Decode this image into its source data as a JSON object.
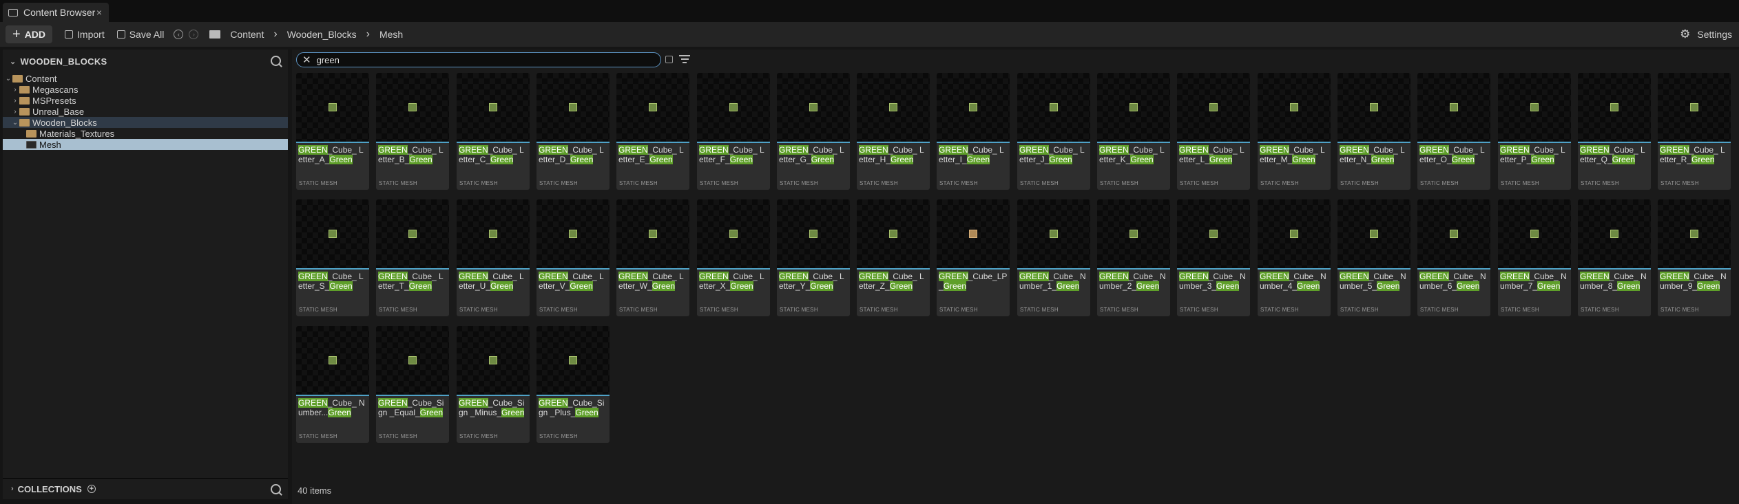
{
  "tab": {
    "title": "Content Browser",
    "close": "×"
  },
  "toolbar": {
    "add_label": "ADD",
    "import_label": "Import",
    "save_all_label": "Save All",
    "breadcrumbs": [
      "Content",
      "Wooden_Blocks",
      "Mesh"
    ],
    "settings_label": "Settings"
  },
  "sources": {
    "title": "WOODEN_BLOCKS",
    "tree": [
      {
        "label": "Content",
        "depth": 0,
        "expanded": true
      },
      {
        "label": "Megascans",
        "depth": 1,
        "expanded": false
      },
      {
        "label": "MSPresets",
        "depth": 1,
        "expanded": false
      },
      {
        "label": "Unreal_Base",
        "depth": 1,
        "expanded": false
      },
      {
        "label": "Wooden_Blocks",
        "depth": 1,
        "expanded": true
      },
      {
        "label": "Materials_Textures",
        "depth": 2,
        "expanded": false
      },
      {
        "label": "Mesh",
        "depth": 2,
        "selected": true
      }
    ]
  },
  "collections": {
    "title": "COLLECTIONS"
  },
  "search": {
    "value": "green"
  },
  "assets": [
    {
      "prefix": "GREEN",
      "middle": "_Cube_ Letter_A_",
      "suffix": "Green",
      "type": "STATIC MESH"
    },
    {
      "prefix": "GREEN",
      "middle": "_Cube_ Letter_B_",
      "suffix": "Green",
      "type": "STATIC MESH"
    },
    {
      "prefix": "GREEN",
      "middle": "_Cube_ Letter_C_",
      "suffix": "Green",
      "type": "STATIC MESH"
    },
    {
      "prefix": "GREEN",
      "middle": "_Cube_ Letter_D_",
      "suffix": "Green",
      "type": "STATIC MESH"
    },
    {
      "prefix": "GREEN",
      "middle": "_Cube_ Letter_E_",
      "suffix": "Green",
      "type": "STATIC MESH"
    },
    {
      "prefix": "GREEN",
      "middle": "_Cube_ Letter_F_",
      "suffix": "Green",
      "type": "STATIC MESH"
    },
    {
      "prefix": "GREEN",
      "middle": "_Cube_ Letter_G_",
      "suffix": "Green",
      "type": "STATIC MESH"
    },
    {
      "prefix": "GREEN",
      "middle": "_Cube_ Letter_H_",
      "suffix": "Green",
      "type": "STATIC MESH"
    },
    {
      "prefix": "GREEN",
      "middle": "_Cube_ Letter_I_",
      "suffix": "Green",
      "type": "STATIC MESH"
    },
    {
      "prefix": "GREEN",
      "middle": "_Cube_ Letter_J_",
      "suffix": "Green",
      "type": "STATIC MESH"
    },
    {
      "prefix": "GREEN",
      "middle": "_Cube_ Letter_K_",
      "suffix": "Green",
      "type": "STATIC MESH"
    },
    {
      "prefix": "GREEN",
      "middle": "_Cube_ Letter_L_",
      "suffix": "Green",
      "type": "STATIC MESH"
    },
    {
      "prefix": "GREEN",
      "middle": "_Cube_ Letter_M_",
      "suffix": "Green",
      "type": "STATIC MESH"
    },
    {
      "prefix": "GREEN",
      "middle": "_Cube_ Letter_N_",
      "suffix": "Green",
      "type": "STATIC MESH"
    },
    {
      "prefix": "GREEN",
      "middle": "_Cube_ Letter_O_",
      "suffix": "Green",
      "type": "STATIC MESH"
    },
    {
      "prefix": "GREEN",
      "middle": "_Cube_ Letter_P_",
      "suffix": "Green",
      "type": "STATIC MESH"
    },
    {
      "prefix": "GREEN",
      "middle": "_Cube_ Letter_Q_",
      "suffix": "Green",
      "type": "STATIC MESH"
    },
    {
      "prefix": "GREEN",
      "middle": "_Cube_ Letter_R_",
      "suffix": "Green",
      "type": "STATIC MESH"
    },
    {
      "prefix": "GREEN",
      "middle": "_Cube_ Letter_S_",
      "suffix": "Green",
      "type": "STATIC MESH"
    },
    {
      "prefix": "GREEN",
      "middle": "_Cube_ Letter_T_",
      "suffix": "Green",
      "type": "STATIC MESH"
    },
    {
      "prefix": "GREEN",
      "middle": "_Cube_ Letter_U_",
      "suffix": "Green",
      "type": "STATIC MESH"
    },
    {
      "prefix": "GREEN",
      "middle": "_Cube_ Letter_V_",
      "suffix": "Green",
      "type": "STATIC MESH"
    },
    {
      "prefix": "GREEN",
      "middle": "_Cube_ Letter_W_",
      "suffix": "Green",
      "type": "STATIC MESH"
    },
    {
      "prefix": "GREEN",
      "middle": "_Cube_ Letter_X_",
      "suffix": "Green",
      "type": "STATIC MESH"
    },
    {
      "prefix": "GREEN",
      "middle": "_Cube_ Letter_Y_",
      "suffix": "Green",
      "type": "STATIC MESH"
    },
    {
      "prefix": "GREEN",
      "middle": "_Cube_ Letter_Z_",
      "suffix": "Green",
      "type": "STATIC MESH"
    },
    {
      "prefix": "GREEN",
      "middle": "_Cube_LP_",
      "suffix": "Green",
      "type": "STATIC MESH",
      "orange": true
    },
    {
      "prefix": "GREEN",
      "middle": "_Cube_ Number_1_",
      "suffix": "Green",
      "type": "STATIC MESH"
    },
    {
      "prefix": "GREEN",
      "middle": "_Cube_ Number_2_",
      "suffix": "Green",
      "type": "STATIC MESH"
    },
    {
      "prefix": "GREEN",
      "middle": "_Cube_ Number_3_",
      "suffix": "Green",
      "type": "STATIC MESH"
    },
    {
      "prefix": "GREEN",
      "middle": "_Cube_ Number_4_",
      "suffix": "Green",
      "type": "STATIC MESH"
    },
    {
      "prefix": "GREEN",
      "middle": "_Cube_ Number_5_",
      "suffix": "Green",
      "type": "STATIC MESH"
    },
    {
      "prefix": "GREEN",
      "middle": "_Cube_ Number_6_",
      "suffix": "Green",
      "type": "STATIC MESH"
    },
    {
      "prefix": "GREEN",
      "middle": "_Cube_ Number_7_",
      "suffix": "Green",
      "type": "STATIC MESH"
    },
    {
      "prefix": "GREEN",
      "middle": "_Cube_ Number_8_",
      "suffix": "Green",
      "type": "STATIC MESH"
    },
    {
      "prefix": "GREEN",
      "middle": "_Cube_ Number_9_",
      "suffix": "Green",
      "type": "STATIC MESH"
    },
    {
      "prefix": "GREEN",
      "middle": "_Cube_ Number...",
      "suffix": "Green",
      "type": "STATIC MESH"
    },
    {
      "prefix": "GREEN",
      "middle": "_Cube_Sign _Equal_",
      "suffix": "Green",
      "type": "STATIC MESH"
    },
    {
      "prefix": "GREEN",
      "middle": "_Cube_Sign _Minus_",
      "suffix": "Green",
      "type": "STATIC MESH"
    },
    {
      "prefix": "GREEN",
      "middle": "_Cube_Sign _Plus_",
      "suffix": "Green",
      "type": "STATIC MESH"
    }
  ],
  "status": {
    "item_count": "40 items"
  },
  "colors": {
    "search_highlight": "#5f9f2a",
    "selection": "#a8bfd0",
    "accent_line": "#4fa2c7",
    "folder": "#b8945c"
  }
}
